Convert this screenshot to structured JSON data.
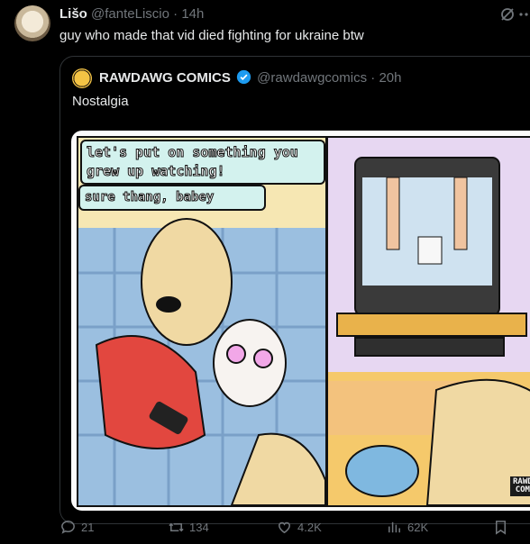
{
  "tweet": {
    "author_name": "Lišo",
    "handle": "@fanteLiscio",
    "separator": "·",
    "time": "14h",
    "text": "guy who made that vid died fighting for ukraine btw",
    "icons": {
      "grok": "grok-icon",
      "more": "more-icon"
    }
  },
  "quote": {
    "author_name": "RAWDAWG COMICS",
    "handle": "@rawdawgcomics",
    "separator": "·",
    "time": "20h",
    "text": "Nostalgia",
    "verified_color": "#1d9bf0",
    "image": {
      "bubble_1": "let's put on something you grew up watching!",
      "bubble_2": "sure thang, babey",
      "watermark_line1": "RAWDAWG",
      "watermark_line2": "COMICS"
    }
  },
  "actions": {
    "replies": "21",
    "reposts": "134",
    "likes": "4.2K",
    "views": "62K"
  },
  "colors": {
    "background": "#000000",
    "text": "#e7e9ea",
    "muted": "#71767b",
    "border": "#2f3336"
  }
}
